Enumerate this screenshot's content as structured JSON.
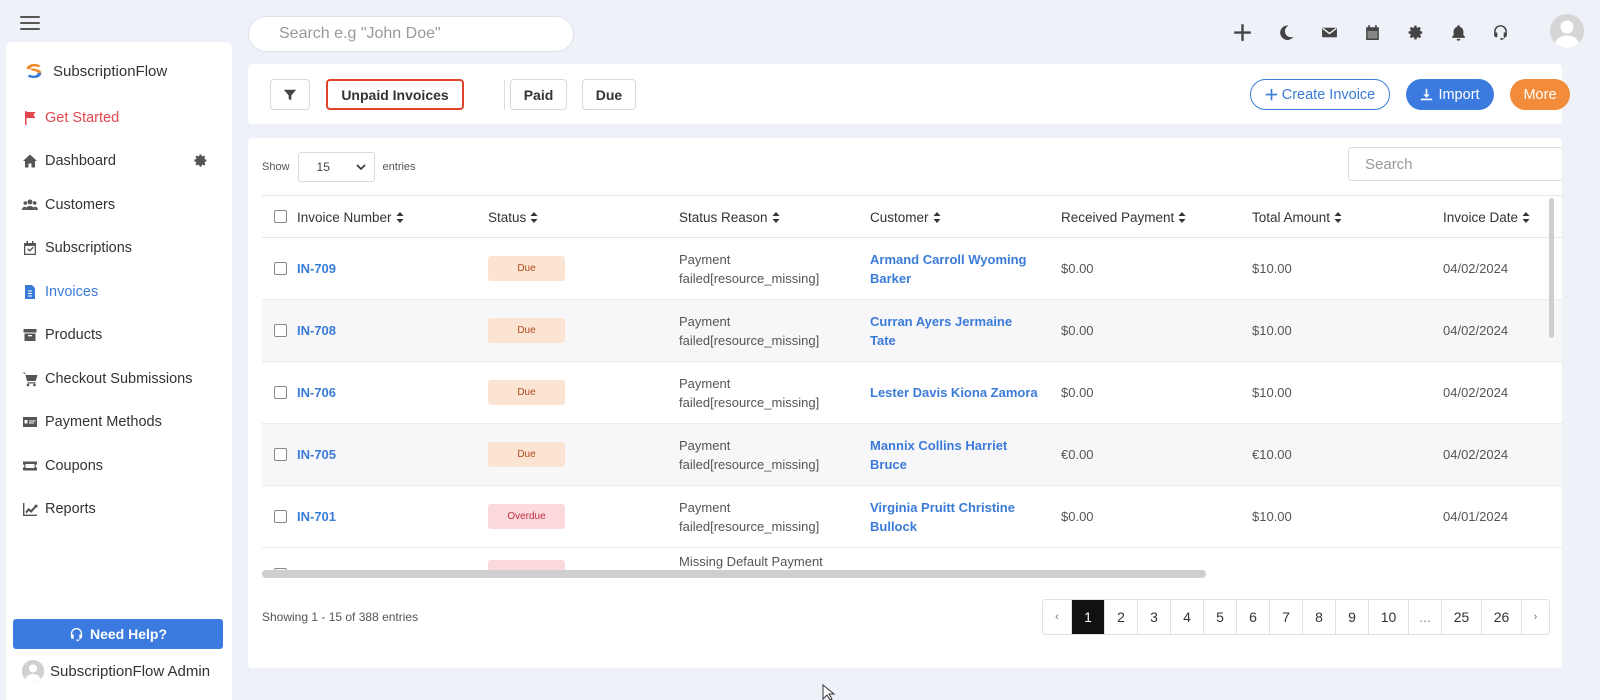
{
  "search": {
    "placeholder": "Search e.g \"John Doe\""
  },
  "brand": {
    "name": "SubscriptionFlow"
  },
  "sidebar": {
    "items": [
      {
        "label": "Get Started",
        "icon": "flag-icon"
      },
      {
        "label": "Dashboard",
        "icon": "home-icon"
      },
      {
        "label": "Customers",
        "icon": "users-icon"
      },
      {
        "label": "Subscriptions",
        "icon": "calendar-check-icon"
      },
      {
        "label": "Invoices",
        "icon": "invoice-icon"
      },
      {
        "label": "Products",
        "icon": "box-icon"
      },
      {
        "label": "Checkout Submissions",
        "icon": "cart-icon"
      },
      {
        "label": "Payment Methods",
        "icon": "payment-icon"
      },
      {
        "label": "Coupons",
        "icon": "ticket-icon"
      },
      {
        "label": "Reports",
        "icon": "chart-line-icon"
      }
    ],
    "help_label": "Need Help?",
    "user_name": "SubscriptionFlow Admin"
  },
  "topbar": {
    "icons": [
      "plus-icon",
      "moon-icon",
      "mail-icon",
      "calendar-icon",
      "gear-icon",
      "bell-icon",
      "headset-icon",
      "avatar"
    ]
  },
  "filters": {
    "unpaid_label": "Unpaid Invoices",
    "paid_label": "Paid",
    "due_label": "Due",
    "create_label": "Create Invoice",
    "import_label": "Import",
    "more_label": "More"
  },
  "table": {
    "show_label": "Show",
    "entries_value": "15",
    "entries_label": "entries",
    "search_placeholder": "Search",
    "columns": [
      "Invoice Number",
      "Status",
      "Status Reason",
      "Customer",
      "Received Payment",
      "Total Amount",
      "Invoice Date"
    ],
    "rows": [
      {
        "invoice": "IN-709",
        "status": "Due",
        "reason_1": "Payment",
        "reason_2": "failed[resource_missing]",
        "cust_1": "Armand Carroll Wyoming",
        "cust_2": "Barker",
        "received": "$0.00",
        "total": "$10.00",
        "date": "04/02/2024"
      },
      {
        "invoice": "IN-708",
        "status": "Due",
        "reason_1": "Payment",
        "reason_2": "failed[resource_missing]",
        "cust_1": "Curran Ayers Jermaine",
        "cust_2": "Tate",
        "received": "$0.00",
        "total": "$10.00",
        "date": "04/02/2024"
      },
      {
        "invoice": "IN-706",
        "status": "Due",
        "reason_1": "Payment",
        "reason_2": "failed[resource_missing]",
        "cust_1": "Lester Davis Kiona Zamora",
        "cust_2": "",
        "received": "$0.00",
        "total": "$10.00",
        "date": "04/02/2024"
      },
      {
        "invoice": "IN-705",
        "status": "Due",
        "reason_1": "Payment",
        "reason_2": "failed[resource_missing]",
        "cust_1": "Mannix Collins Harriet",
        "cust_2": "Bruce",
        "received": "€0.00",
        "total": "€10.00",
        "date": "04/02/2024"
      },
      {
        "invoice": "IN-701",
        "status": "Overdue",
        "reason_1": "Payment",
        "reason_2": "failed[resource_missing]",
        "cust_1": "Virginia Pruitt Christine",
        "cust_2": "Bullock",
        "received": "$0.00",
        "total": "$10.00",
        "date": "04/01/2024"
      }
    ],
    "partial_reason": "Missing Default Payment",
    "showing_text": "Showing 1 - 15 of 388 entries"
  },
  "pagination": {
    "prev": "‹",
    "pages": [
      "1",
      "2",
      "3",
      "4",
      "5",
      "6",
      "7",
      "8",
      "9",
      "10",
      "...",
      "25",
      "26"
    ],
    "next": "›",
    "current": "1"
  }
}
